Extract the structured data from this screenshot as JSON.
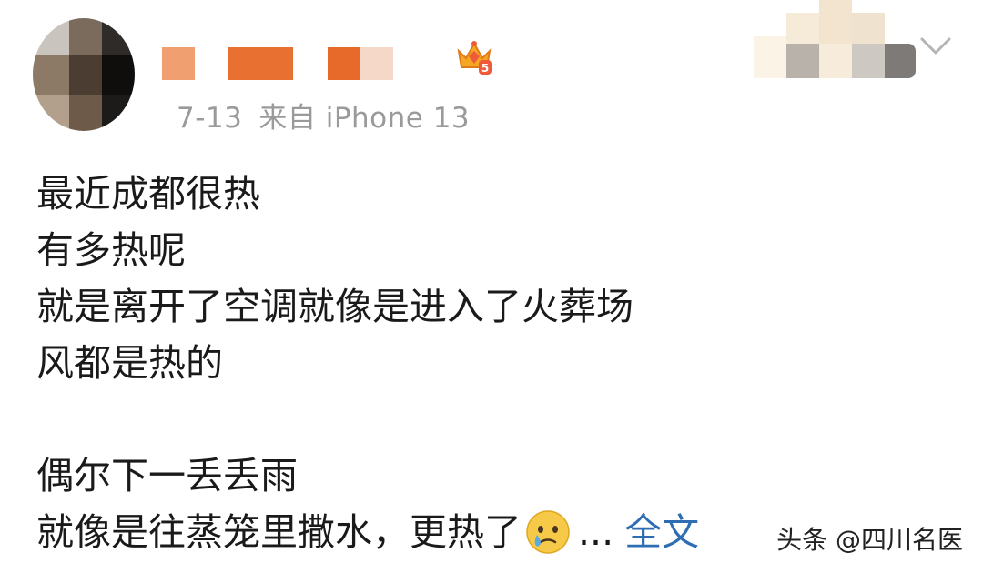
{
  "post": {
    "date": "7-13",
    "source": "来自 iPhone 13",
    "lines": [
      "最近成都很热",
      "有多热呢",
      "就是离开了空调就像是进入了火葬场",
      "风都是热的",
      "",
      "偶尔下一丢丢雨"
    ],
    "last_line_text": "就像是往蒸笼里撒水，更热了",
    "ellipsis": "...",
    "full_text_link": "全文"
  },
  "header": {
    "badge_icon": "crown-vip-level-icon",
    "badge_level": "5",
    "menu_icon": "chevron-down-icon"
  },
  "watermark": "头条 @四川名医",
  "colors": {
    "link": "#2f6db3",
    "meta": "#9a9a9a",
    "name_orange": "#e86a2b",
    "crown_red": "#f05a3a",
    "crown_gold": "#f5a623"
  }
}
